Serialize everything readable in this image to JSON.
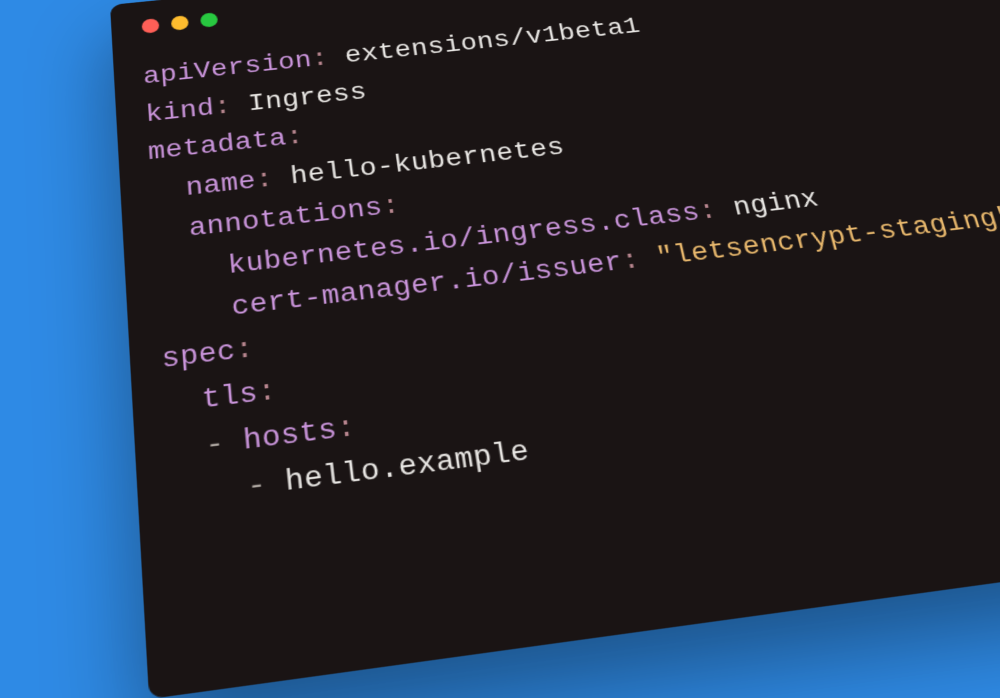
{
  "titlebar": {
    "dots": [
      "close",
      "minimize",
      "zoom"
    ]
  },
  "yaml": {
    "l0_key": "apiVersion",
    "l0_val": "extensions/v1beta1",
    "l1_key": "kind",
    "l1_val": "Ingress",
    "l2_key": "metadata",
    "l3_key": "name",
    "l3_val": "hello-kubernetes",
    "l4_key": "annotations",
    "l5_key": "kubernetes.io/ingress.class",
    "l5_val": "nginx",
    "l6_key": "cert-manager.io/issuer",
    "l6_val": "\"letsencrypt-staging\"",
    "l7_key": "spec",
    "l8_key": "tls",
    "l9_key": "hosts",
    "l10_val": "hello.example"
  }
}
